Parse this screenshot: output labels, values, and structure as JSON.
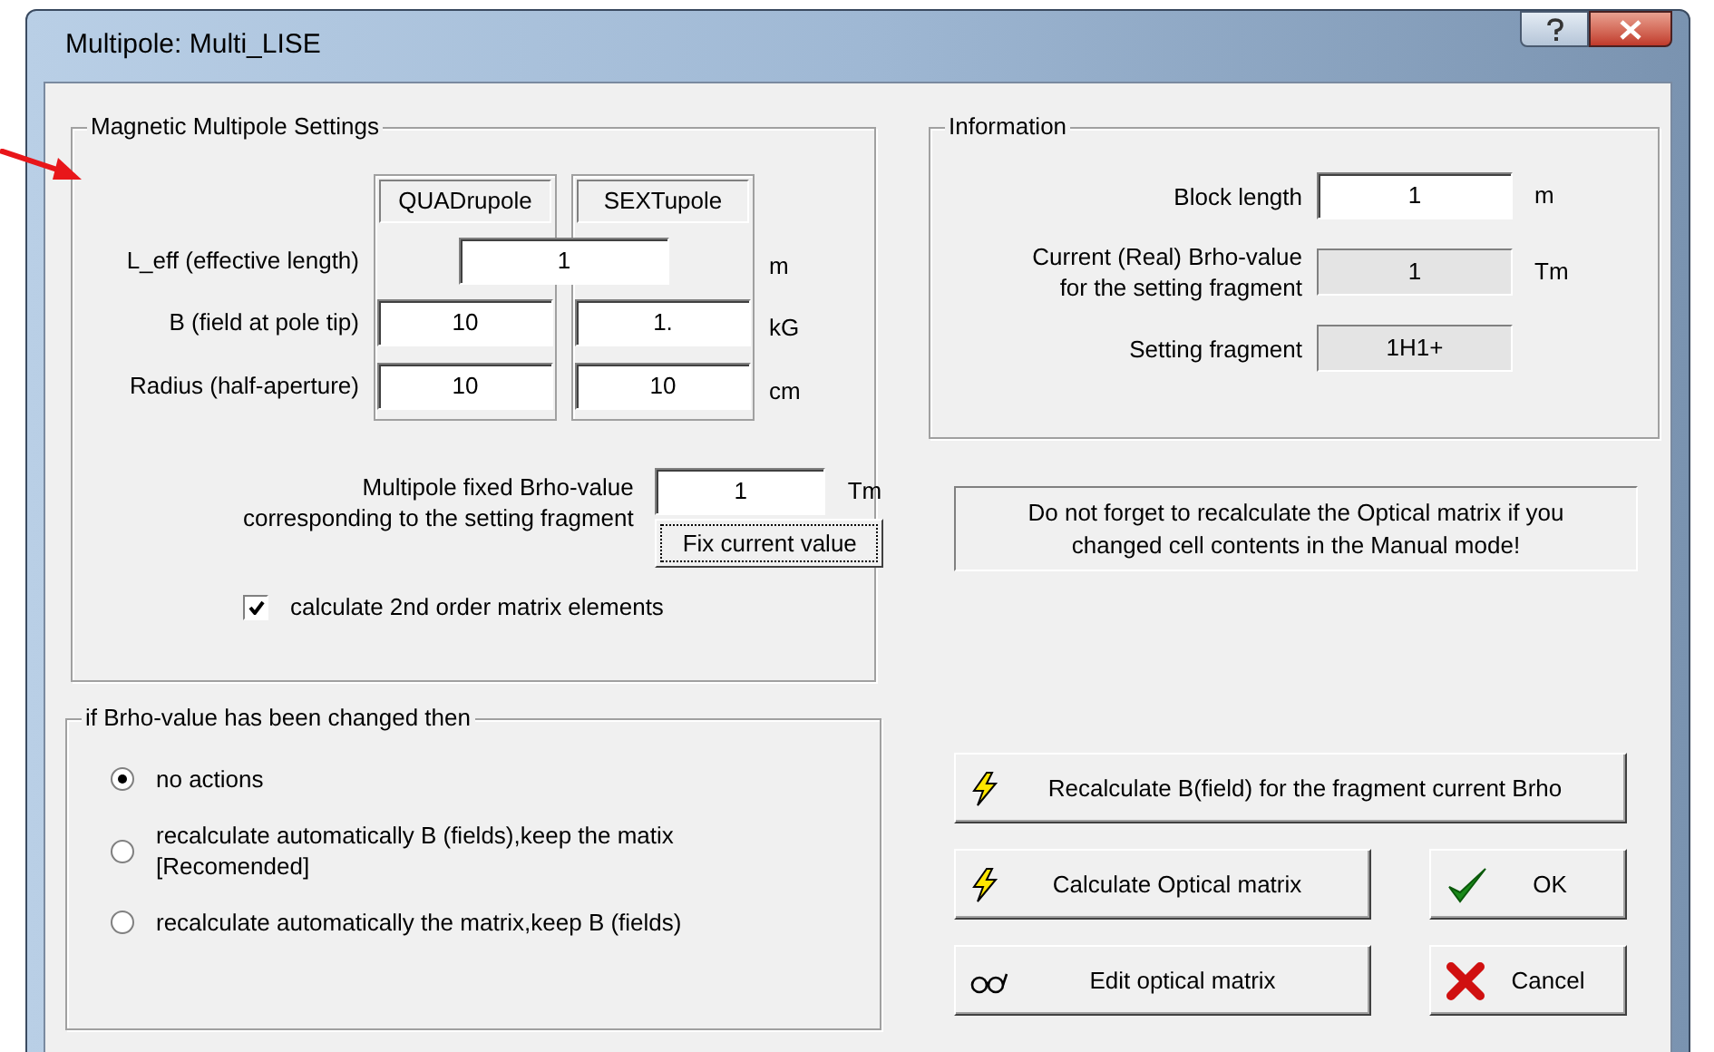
{
  "window": {
    "title": "Multipole: Multi_LISE"
  },
  "multipole_settings": {
    "title": "Magnetic Multipole Settings",
    "columns": [
      "QUADrupole",
      "SEXTupole"
    ],
    "rows": [
      {
        "label": "L_eff (effective length)",
        "values": [
          "1"
        ],
        "unit": "m"
      },
      {
        "label": "B (field at pole tip)",
        "values": [
          "10",
          "1."
        ],
        "unit": "kG"
      },
      {
        "label": "Radius (half-aperture)",
        "values": [
          "10",
          "10"
        ],
        "unit": "cm"
      }
    ],
    "fixed_brho": {
      "label_lines": [
        "Multipole fixed Brho-value",
        "corresponding to the setting fragment"
      ],
      "value": "1",
      "unit": "Tm"
    },
    "fix_button": "Fix current value",
    "second_order": {
      "label": "calculate 2nd order matrix elements",
      "checked": true
    }
  },
  "information": {
    "title": "Information",
    "rows": [
      {
        "label_lines": [
          "Block length"
        ],
        "value": "1",
        "unit": "m",
        "editable": true
      },
      {
        "label_lines": [
          "Current (Real) Brho-value",
          "for the setting fragment"
        ],
        "value": "1",
        "unit": "Tm",
        "editable": false
      },
      {
        "label_lines": [
          "Setting fragment"
        ],
        "value": "1H1+",
        "editable": false
      }
    ]
  },
  "note": "Do not forget to recalculate the Optical matrix if you changed cell contents in the Manual mode!",
  "brho_action": {
    "title": "if Brho-value has been changed then",
    "options": [
      {
        "lines": [
          "no actions"
        ],
        "selected": true
      },
      {
        "lines": [
          "recalculate automatically B (fields),keep the matix",
          "[Recomended]"
        ],
        "selected": false
      },
      {
        "lines": [
          "recalculate automatically the matrix,keep  B (fields)"
        ],
        "selected": false
      }
    ]
  },
  "buttons": [
    {
      "label": "Recalculate B(field) for the fragment current Brho",
      "kind": "lightning"
    },
    {
      "label": "Calculate Optical matrix",
      "kind": "lightning"
    },
    {
      "label": "OK",
      "kind": "check"
    },
    {
      "label": "Edit optical matrix",
      "kind": "glasses"
    },
    {
      "label": "Cancel",
      "kind": "cross"
    }
  ]
}
